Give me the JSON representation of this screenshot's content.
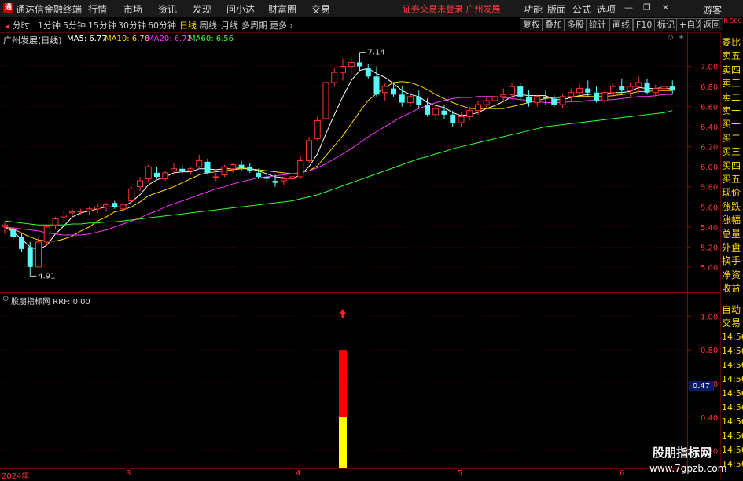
{
  "menubar": {
    "logo_glyph": "通",
    "app_title": "通达信金融终端",
    "items": [
      "行情",
      "市场",
      "资讯",
      "发现",
      "问小达",
      "财富圈",
      "交易"
    ],
    "status": "证券交易未登录  广州发展",
    "right_items": [
      "功能",
      "版面",
      "公式",
      "选项"
    ],
    "guest": "游客"
  },
  "toolbar": {
    "periods": [
      "分时",
      "1分钟",
      "5分钟",
      "15分钟",
      "30分钟",
      "60分钟",
      "日线",
      "周线",
      "月线",
      "多周期",
      "更多"
    ],
    "active_period": "日线",
    "buttons": [
      "复权",
      "叠加",
      "多股",
      "统计",
      "画线",
      "F10",
      "标记",
      "+自选",
      "返回"
    ]
  },
  "chart": {
    "title": "广州发展(日线)",
    "ma": [
      {
        "label": "MA5: 6.77",
        "color": "#ffffff"
      },
      {
        "label": "MA10: 6.76",
        "color": "#ffd800"
      },
      {
        "label": "MA20: 6.72",
        "color": "#ff33ff"
      },
      {
        "label": "MA60: 6.56",
        "color": "#33ff33"
      }
    ],
    "high_label": "7.14",
    "low_label": "4.91",
    "price_ticks": [
      "7.00",
      "6.80",
      "6.60",
      "6.40",
      "6.20",
      "6.00",
      "5.80",
      "5.60",
      "5.40",
      "5.20",
      "5.00"
    ],
    "indicator_title": "股朋指标网  RRF: 0.00",
    "indicator_ticks": [
      "1.00",
      "0.80",
      "0.60",
      "0.40",
      "0.20"
    ],
    "indicator_cursor": "0.47",
    "dates": [
      "2024年",
      "3",
      "4",
      "5",
      "6"
    ]
  },
  "chart_data": {
    "type": "candlestick",
    "title": "广州发展(日线)",
    "ylim": [
      4.85,
      7.2
    ],
    "candles": [
      [
        5.4,
        5.45,
        5.33,
        5.42
      ],
      [
        5.38,
        5.4,
        5.28,
        5.3
      ],
      [
        5.3,
        5.34,
        5.15,
        5.18
      ],
      [
        5.2,
        5.25,
        4.91,
        5.0
      ],
      [
        5.0,
        5.3,
        5.0,
        5.25
      ],
      [
        5.25,
        5.42,
        5.22,
        5.4
      ],
      [
        5.42,
        5.5,
        5.38,
        5.48
      ],
      [
        5.5,
        5.56,
        5.45,
        5.52
      ],
      [
        5.54,
        5.58,
        5.5,
        5.55
      ],
      [
        5.55,
        5.58,
        5.52,
        5.56
      ],
      [
        5.56,
        5.6,
        5.52,
        5.58
      ],
      [
        5.58,
        5.63,
        5.54,
        5.6
      ],
      [
        5.6,
        5.64,
        5.55,
        5.62
      ],
      [
        5.64,
        5.66,
        5.58,
        5.6
      ],
      [
        5.58,
        5.64,
        5.56,
        5.62
      ],
      [
        5.66,
        5.8,
        5.64,
        5.78
      ],
      [
        5.8,
        5.9,
        5.76,
        5.86
      ],
      [
        5.88,
        6.02,
        5.84,
        6.0
      ],
      [
        5.94,
        6.0,
        5.88,
        5.9
      ],
      [
        5.88,
        5.96,
        5.86,
        5.94
      ],
      [
        5.96,
        6.04,
        5.92,
        5.98
      ],
      [
        5.98,
        6.02,
        5.92,
        5.96
      ],
      [
        5.96,
        6.0,
        5.92,
        5.98
      ],
      [
        6.0,
        6.12,
        5.98,
        6.06
      ],
      [
        6.05,
        6.08,
        5.92,
        5.94
      ],
      [
        5.9,
        5.94,
        5.86,
        5.9
      ],
      [
        5.92,
        6.02,
        5.9,
        6.0
      ],
      [
        5.98,
        6.04,
        5.94,
        6.02
      ],
      [
        6.02,
        6.06,
        5.96,
        6.0
      ],
      [
        6.0,
        6.04,
        5.94,
        5.96
      ],
      [
        5.94,
        5.98,
        5.88,
        5.9
      ],
      [
        5.9,
        5.94,
        5.84,
        5.88
      ],
      [
        5.86,
        5.92,
        5.8,
        5.84
      ],
      [
        5.86,
        5.9,
        5.82,
        5.88
      ],
      [
        5.88,
        5.92,
        5.84,
        5.9
      ],
      [
        5.9,
        6.1,
        5.88,
        6.06
      ],
      [
        6.06,
        6.3,
        6.04,
        6.26
      ],
      [
        6.28,
        6.5,
        6.26,
        6.46
      ],
      [
        6.48,
        6.88,
        6.46,
        6.84
      ],
      [
        6.84,
        6.98,
        6.8,
        6.94
      ],
      [
        6.94,
        7.08,
        6.86,
        7.0
      ],
      [
        7.0,
        7.1,
        6.9,
        7.04
      ],
      [
        7.04,
        7.14,
        6.96,
        7.0
      ],
      [
        6.98,
        7.02,
        6.88,
        6.9
      ],
      [
        6.9,
        7.0,
        6.7,
        6.72
      ],
      [
        6.74,
        6.84,
        6.66,
        6.8
      ],
      [
        6.78,
        6.84,
        6.7,
        6.72
      ],
      [
        6.72,
        6.8,
        6.6,
        6.64
      ],
      [
        6.64,
        6.74,
        6.6,
        6.7
      ],
      [
        6.7,
        6.76,
        6.58,
        6.62
      ],
      [
        6.62,
        6.68,
        6.5,
        6.52
      ],
      [
        6.52,
        6.62,
        6.46,
        6.58
      ],
      [
        6.56,
        6.62,
        6.48,
        6.52
      ],
      [
        6.52,
        6.56,
        6.4,
        6.44
      ],
      [
        6.44,
        6.54,
        6.4,
        6.5
      ],
      [
        6.5,
        6.6,
        6.46,
        6.56
      ],
      [
        6.56,
        6.66,
        6.52,
        6.62
      ],
      [
        6.62,
        6.7,
        6.58,
        6.66
      ],
      [
        6.66,
        6.74,
        6.62,
        6.7
      ],
      [
        6.7,
        6.78,
        6.64,
        6.72
      ],
      [
        6.72,
        6.84,
        6.68,
        6.8
      ],
      [
        6.8,
        6.84,
        6.66,
        6.7
      ],
      [
        6.7,
        6.76,
        6.6,
        6.64
      ],
      [
        6.64,
        6.72,
        6.6,
        6.7
      ],
      [
        6.7,
        6.76,
        6.62,
        6.68
      ],
      [
        6.68,
        6.72,
        6.58,
        6.62
      ],
      [
        6.62,
        6.72,
        6.58,
        6.7
      ],
      [
        6.7,
        6.78,
        6.66,
        6.74
      ],
      [
        6.74,
        6.84,
        6.68,
        6.78
      ],
      [
        6.78,
        6.86,
        6.7,
        6.74
      ],
      [
        6.74,
        6.8,
        6.64,
        6.66
      ],
      [
        6.66,
        6.76,
        6.62,
        6.74
      ],
      [
        6.74,
        6.82,
        6.7,
        6.8
      ],
      [
        6.8,
        6.88,
        6.72,
        6.76
      ],
      [
        6.76,
        6.84,
        6.7,
        6.8
      ],
      [
        6.8,
        6.9,
        6.74,
        6.84
      ],
      [
        6.84,
        6.88,
        6.72,
        6.74
      ],
      [
        6.74,
        6.82,
        6.7,
        6.78
      ],
      [
        6.78,
        6.96,
        6.74,
        6.8
      ],
      [
        6.8,
        6.86,
        6.72,
        6.76
      ]
    ],
    "ma_series": {
      "MA5": [
        5.4,
        5.35,
        5.28,
        5.2,
        5.17,
        5.22,
        5.33,
        5.41,
        5.5,
        5.54,
        5.56,
        5.58,
        5.6,
        5.6,
        5.6,
        5.65,
        5.72,
        5.82,
        5.87,
        5.9,
        5.94,
        5.95,
        5.95,
        5.98,
        5.98,
        5.97,
        5.98,
        5.98,
        5.99,
        5.98,
        5.96,
        5.93,
        5.9,
        5.89,
        5.88,
        5.92,
        6.0,
        6.13,
        6.33,
        6.52,
        6.7,
        6.86,
        6.96,
        6.98,
        6.93,
        6.89,
        6.83,
        6.76,
        6.72,
        6.7,
        6.64,
        6.61,
        6.59,
        6.54,
        6.51,
        6.52,
        6.54,
        6.58,
        6.61,
        6.65,
        6.7,
        6.72,
        6.71,
        6.71,
        6.71,
        6.67,
        6.67,
        6.69,
        6.71,
        6.72,
        6.73,
        6.73,
        6.74,
        6.74,
        6.75,
        6.79,
        6.78,
        6.78,
        6.79,
        6.77
      ],
      "MA10": [
        5.4,
        5.38,
        5.34,
        5.3,
        5.27,
        5.26,
        5.26,
        5.28,
        5.31,
        5.36,
        5.4,
        5.46,
        5.5,
        5.55,
        5.57,
        5.6,
        5.65,
        5.71,
        5.74,
        5.77,
        5.8,
        5.84,
        5.88,
        5.92,
        5.94,
        5.95,
        5.96,
        5.97,
        5.98,
        5.98,
        5.97,
        5.96,
        5.95,
        5.94,
        5.93,
        5.94,
        5.96,
        6.01,
        6.11,
        6.21,
        6.31,
        6.43,
        6.55,
        6.66,
        6.73,
        6.79,
        6.84,
        6.85,
        6.84,
        6.81,
        6.77,
        6.72,
        6.68,
        6.64,
        6.61,
        6.58,
        6.58,
        6.58,
        6.58,
        6.58,
        6.6,
        6.62,
        6.64,
        6.66,
        6.68,
        6.69,
        6.69,
        6.7,
        6.7,
        6.7,
        6.7,
        6.7,
        6.71,
        6.72,
        6.73,
        6.75,
        6.75,
        6.76,
        6.76,
        6.76
      ],
      "MA20": [
        5.4,
        5.39,
        5.38,
        5.37,
        5.36,
        5.34,
        5.33,
        5.32,
        5.32,
        5.32,
        5.33,
        5.35,
        5.37,
        5.4,
        5.43,
        5.46,
        5.49,
        5.53,
        5.56,
        5.6,
        5.63,
        5.66,
        5.69,
        5.72,
        5.75,
        5.78,
        5.8,
        5.83,
        5.85,
        5.87,
        5.89,
        5.9,
        5.91,
        5.92,
        5.93,
        5.94,
        5.96,
        5.99,
        6.03,
        6.08,
        6.13,
        6.18,
        6.24,
        6.3,
        6.35,
        6.4,
        6.45,
        6.5,
        6.54,
        6.58,
        6.61,
        6.64,
        6.66,
        6.68,
        6.69,
        6.69,
        6.7,
        6.7,
        6.7,
        6.69,
        6.68,
        6.67,
        6.66,
        6.65,
        6.64,
        6.64,
        6.64,
        6.65,
        6.65,
        6.66,
        6.66,
        6.67,
        6.67,
        6.68,
        6.69,
        6.7,
        6.7,
        6.71,
        6.72,
        6.72
      ],
      "MA60": [
        5.46,
        5.45,
        5.44,
        5.43,
        5.42,
        5.42,
        5.42,
        5.42,
        5.43,
        5.43,
        5.44,
        5.44,
        5.45,
        5.45,
        5.46,
        5.47,
        5.48,
        5.49,
        5.5,
        5.51,
        5.52,
        5.53,
        5.54,
        5.55,
        5.56,
        5.57,
        5.58,
        5.59,
        5.6,
        5.61,
        5.62,
        5.63,
        5.64,
        5.65,
        5.66,
        5.68,
        5.7,
        5.72,
        5.75,
        5.78,
        5.81,
        5.84,
        5.87,
        5.9,
        5.93,
        5.96,
        5.99,
        6.02,
        6.05,
        6.08,
        6.1,
        6.13,
        6.15,
        6.18,
        6.2,
        6.22,
        6.24,
        6.26,
        6.28,
        6.3,
        6.32,
        6.34,
        6.36,
        6.38,
        6.4,
        6.41,
        6.42,
        6.43,
        6.44,
        6.45,
        6.46,
        6.47,
        6.48,
        6.49,
        6.5,
        6.51,
        6.52,
        6.53,
        6.54,
        6.56
      ]
    },
    "indicator": {
      "name": "RRF",
      "bar_index": 40,
      "yellow_value": 0.4,
      "red_value": 0.8,
      "ylim": [
        0.1,
        1.1
      ]
    }
  },
  "right_panel": {
    "items": [
      "委比",
      "卖五",
      "卖四",
      "卖三",
      "卖二",
      "卖一",
      "买一",
      "买二",
      "买三",
      "买四",
      "买五",
      "现价",
      "涨跌",
      "涨幅",
      "总量",
      "外盘",
      "换手",
      "净资",
      "收益"
    ],
    "trade_items": [
      "自动",
      "交易"
    ],
    "times": [
      "14:56",
      "14:56",
      "14:56",
      "14:56",
      "14:56",
      "14:56",
      "14:56",
      "14:56",
      "14:56",
      "14:56"
    ],
    "corner": "R 500"
  },
  "watermark": {
    "line1": "股朋指标网",
    "line2": "www.7gpzb.com"
  },
  "colors": {
    "up": "#ff3232",
    "down": "#54fcfc",
    "axis": "#8b0000",
    "yellow": "#ffff00",
    "red": "#ff0000"
  }
}
